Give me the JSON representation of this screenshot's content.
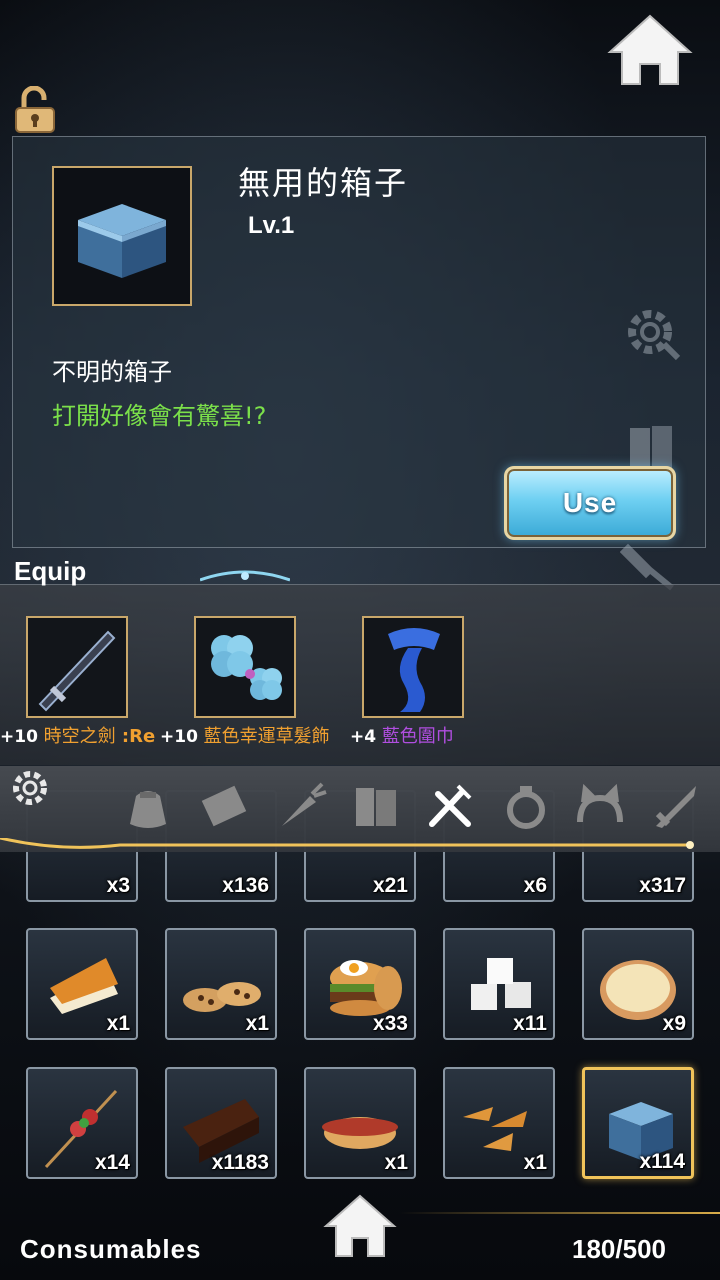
{
  "detail": {
    "name": "無用的箱子",
    "level": "Lv.1",
    "description": "不明的箱子",
    "flavor": "打開好像會有驚喜!?",
    "use_label": "Use"
  },
  "equip": {
    "label": "Equip",
    "items": [
      {
        "plus": "+10",
        "name": "時空之劍",
        "suffix": " :Re",
        "color": "#f0a030"
      },
      {
        "plus": "+10",
        "name": "藍色幸運草髮飾",
        "suffix": "",
        "color": "#f0a030"
      },
      {
        "plus": "+4",
        "name": "藍色圍巾",
        "suffix": "",
        "color": "#b04ee0"
      }
    ]
  },
  "tabs": [
    "bag-icon",
    "scroll-icon",
    "carrot-icon",
    "books-icon",
    "fork-knife-icon",
    "ring-icon",
    "cat-ears-icon",
    "sword-icon"
  ],
  "inventory": {
    "row0": [
      "x3",
      "x136",
      "x21",
      "x6",
      "x317"
    ],
    "row1": [
      "x1",
      "x1",
      "x33",
      "x11",
      "x9"
    ],
    "row2": [
      "x14",
      "x1183",
      "x1",
      "x1",
      "x114"
    ],
    "row1_icons": [
      "cheesecake-icon",
      "cookies-icon",
      "burger-icon",
      "sugar-cubes-icon",
      "pizza-icon"
    ],
    "row2_icons": [
      "skewer-icon",
      "chocolate-cake-icon",
      "hotdog-icon",
      "potato-wedges-icon",
      "blue-box-icon"
    ]
  },
  "footer": {
    "category": "Consumables",
    "capacity": "180/500"
  },
  "colors": {
    "accent_gold": "#c9a76a",
    "flavor_green": "#7be04a",
    "use_blue": "#6fd0f2"
  }
}
